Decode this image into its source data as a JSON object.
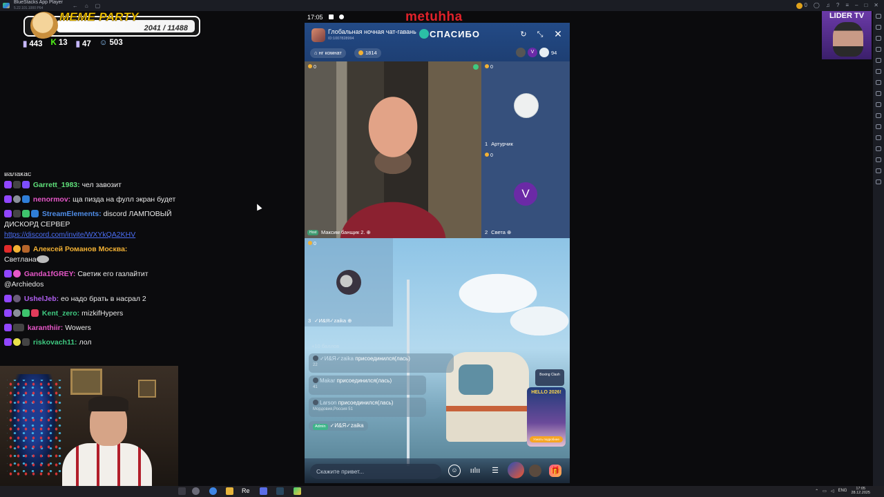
{
  "window": {
    "title": "BlueStacks App Player",
    "subtitle": "5.22.101.1000 P64",
    "coin_count": "0"
  },
  "overlay": {
    "meme_title": "MEME PARTY",
    "meme_score": "2041 / 11488",
    "stats": [
      {
        "icon": "chat-bubble-icon",
        "value": "443"
      },
      {
        "icon": "kick-icon",
        "value": "13"
      },
      {
        "icon": "twitch-icon",
        "value": "47"
      },
      {
        "icon": "user-icon",
        "value": "503"
      }
    ],
    "channel_badge": "LIDER TV"
  },
  "chat": {
    "partial_line": "валакас",
    "messages": [
      {
        "user": "Garrett_1983:",
        "color": "#5fe07a",
        "text": "чел завозит"
      },
      {
        "user": "nenormov:",
        "color": "#e657c8",
        "text": "ща пизда на фулл экран будет"
      },
      {
        "user": "StreamElements:",
        "color": "#4f8de8",
        "text": "discord ЛАМПОВЫЙ ДИСКОРД СЕРВЕР",
        "link": "https://discord.com/invite/WXYkQA2KHV"
      },
      {
        "user": "Алексей Романов Москва:",
        "color": "#f2b134",
        "text": "Светлана"
      },
      {
        "user": "Ganda1fGREY:",
        "color": "#e657c8",
        "text": "Светик его газлайтит @Archiedos"
      },
      {
        "user": "UshelJeb:",
        "color": "#b05ff0",
        "text": "ео надо брать в насрал 2"
      },
      {
        "user": "Kent_zero:",
        "color": "#3fc980",
        "text": "mizkifHypers"
      },
      {
        "user": "karanthiir:",
        "color": "#e657c8",
        "text": "Wowers"
      },
      {
        "user": "riskovach11:",
        "color": "#3fc980",
        "text": "лол"
      }
    ]
  },
  "phone": {
    "time": "17:05",
    "overlay_name": "metuhha",
    "room_title": "Глобальная ночная чат-гавань",
    "room_id": "ID:1007828994",
    "thanks_label": "СПАСИБО",
    "room_chip": "нг комнат",
    "coins": "1814",
    "viewer_avatar_v": "V",
    "viewer_count": "94",
    "host": {
      "coins": "0",
      "tag": "Host",
      "name": "Максим банщик 2."
    },
    "seats": [
      {
        "num": "1",
        "name": "Артурчик",
        "coins": "0"
      },
      {
        "num": "2",
        "name": "Света",
        "coins": "0",
        "avatar_letter": "V"
      },
      {
        "num": "3",
        "name": "✓И&Я✓zaika",
        "coins": "0"
      }
    ],
    "points_line": "+10 баллов",
    "joins": [
      {
        "user": "✓И&Я✓zaika",
        "text": "присоединился(лась)",
        "sub": "22"
      },
      {
        "user": "Makar",
        "text": "присоединился(лась)",
        "sub": "41"
      },
      {
        "user": "Larson",
        "text": "присоединился(лась)",
        "sub": "Мордовия,Россия   51"
      }
    ],
    "admin_row": {
      "tag": "Admin",
      "user": "✓И&Я✓zaika"
    },
    "side_card1": "Boxing Clash",
    "side_card2": {
      "title": "HELLO 2026!",
      "button": "Узнать подробнее"
    },
    "input_placeholder": "Скажите привет..."
  },
  "taskbar": {
    "app_label": "Re",
    "lang": "ENG",
    "time": "17:05",
    "date": "28.12.2025"
  },
  "colors": {
    "header": "#234a86",
    "accent_purple": "#9146ff",
    "host_tag": "#3f9a70"
  }
}
